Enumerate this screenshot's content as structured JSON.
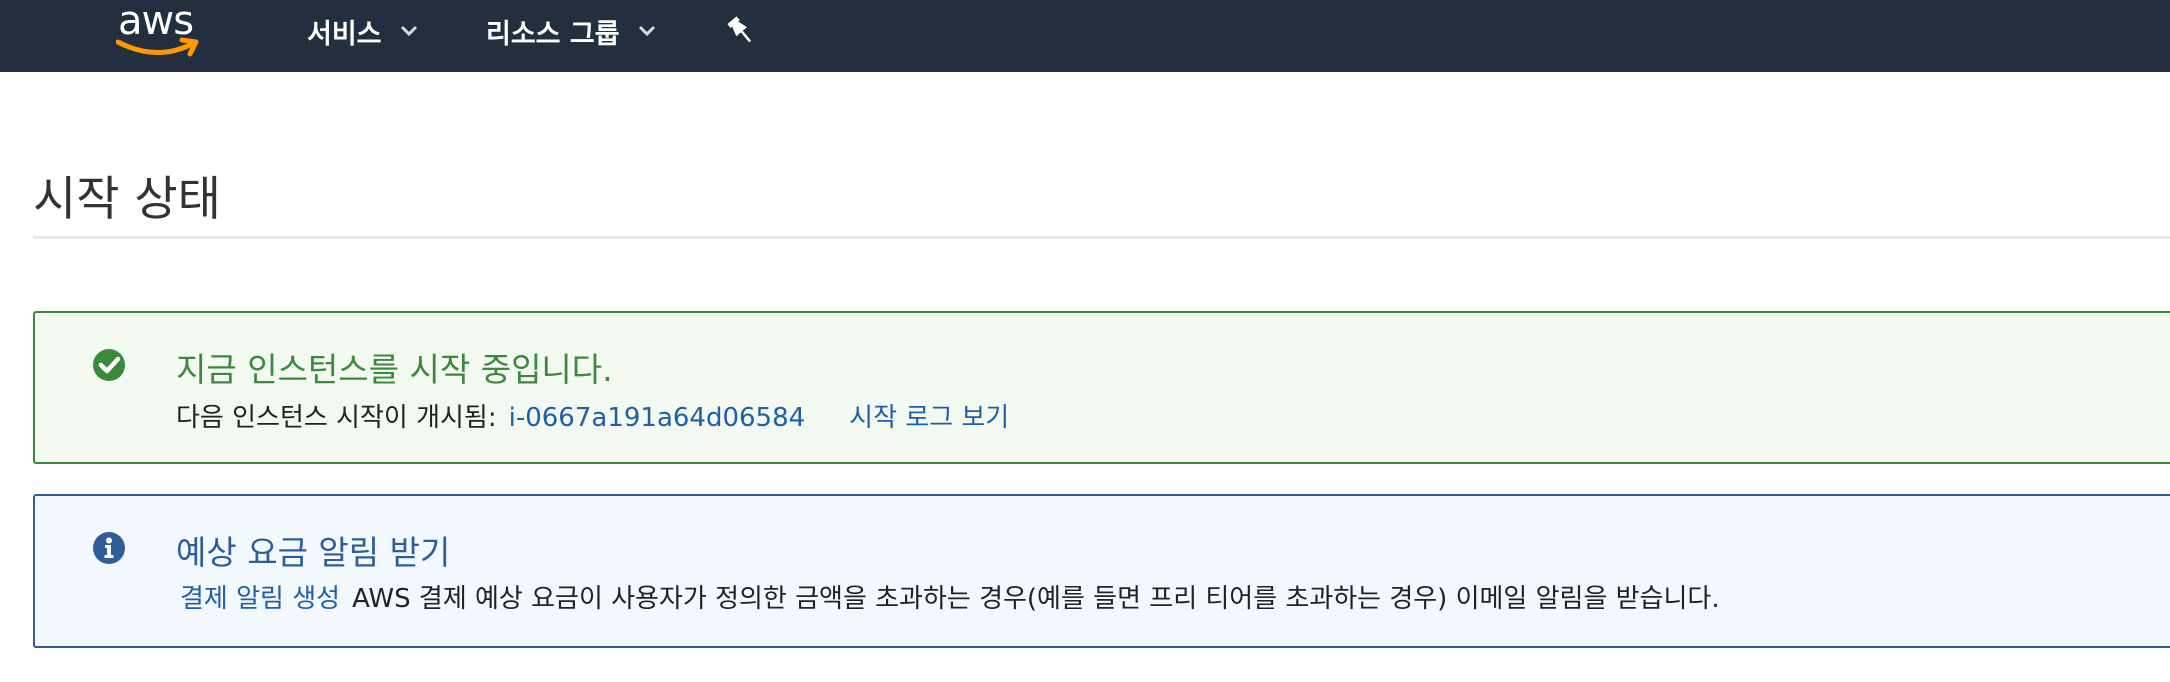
{
  "nav": {
    "logo_text": "aws",
    "services_label": "서비스",
    "resource_groups_label": "리소스 그룹"
  },
  "page": {
    "title": "시작 상태"
  },
  "success_alert": {
    "heading": "지금 인스턴스를 시작 중입니다.",
    "body_prefix": "다음 인스턴스 시작이 개시됨:",
    "instance_id": "i-0667a191a64d06584",
    "view_log_link": "시작 로그 보기"
  },
  "info_alert": {
    "heading": "예상 요금 알림 받기",
    "create_alert_link": "결제 알림 생성",
    "body_text": "AWS 결제 예상 요금이 사용자가 정의한 금액을 초과하는 경우(예를 들면 프리 티어를 초과하는 경우) 이메일 알림을 받습니다."
  },
  "colors": {
    "nav_bg": "#232f3e",
    "aws_orange": "#f90",
    "success": "#3b8a3b",
    "info": "#2e5d9a",
    "link": "#1f5fa8"
  },
  "icons": {
    "logo": "aws-smile-logo",
    "dropdown": "chevron-down-icon",
    "pin": "pushpin-icon",
    "success": "check-circle-icon",
    "info": "info-circle-icon"
  }
}
